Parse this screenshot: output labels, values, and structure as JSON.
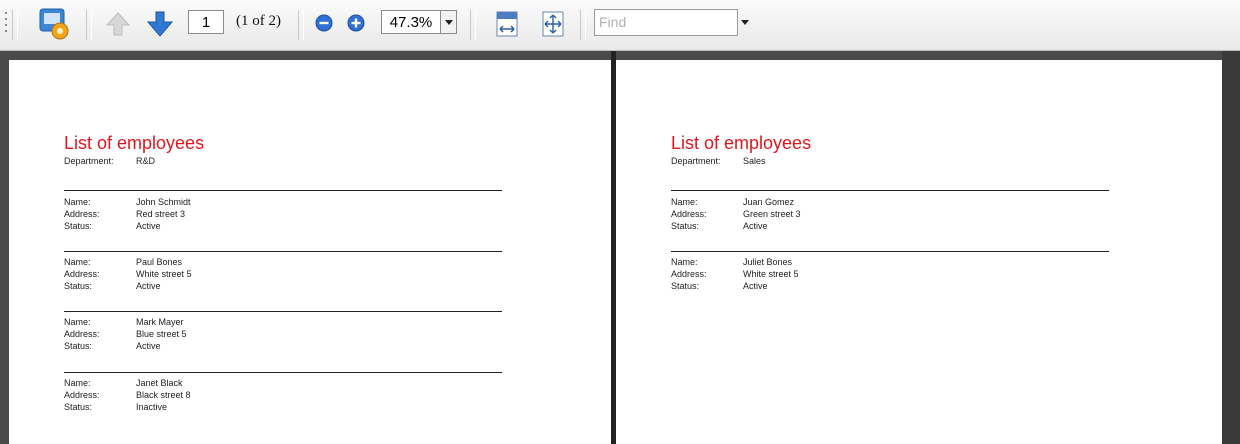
{
  "toolbar": {
    "page_current": "1",
    "page_count_text": "(1 of 2)",
    "zoom_value": "47.3%",
    "find_placeholder": "Find",
    "icons": [
      "settings-icon",
      "previous-page-icon",
      "next-page-icon",
      "zoom-out-icon",
      "zoom-in-icon",
      "fit-width-icon",
      "fit-page-icon"
    ]
  },
  "pages": [
    {
      "title": "List of employees",
      "department_label": "Department:",
      "department_value": "R&D",
      "employees": [
        {
          "name_label": "Name:",
          "name": "John Schmidt",
          "address_label": "Address:",
          "address": "Red street 3",
          "status_label": "Status:",
          "status": "Active"
        },
        {
          "name_label": "Name:",
          "name": "Paul Bones",
          "address_label": "Address:",
          "address": "White street 5",
          "status_label": "Status:",
          "status": "Active"
        },
        {
          "name_label": "Name:",
          "name": "Mark Mayer",
          "address_label": "Address:",
          "address": "Blue street 5",
          "status_label": "Status:",
          "status": "Active"
        },
        {
          "name_label": "Name:",
          "name": "Janet Black",
          "address_label": "Address:",
          "address": "Black street 8",
          "status_label": "Status:",
          "status": "Inactive"
        }
      ]
    },
    {
      "title": "List of employees",
      "department_label": "Department:",
      "department_value": "Sales",
      "employees": [
        {
          "name_label": "Name:",
          "name": "Juan Gomez",
          "address_label": "Address:",
          "address": "Green street 3",
          "status_label": "Status:",
          "status": "Active"
        },
        {
          "name_label": "Name:",
          "name": "Juliet Bones",
          "address_label": "Address:",
          "address": "White street 5",
          "status_label": "Status:",
          "status": "Active"
        }
      ]
    }
  ],
  "colors": {
    "title": "#e0161f",
    "arrow_blue": "#2f78d4",
    "zoom_blue": "#2f6fd6"
  }
}
